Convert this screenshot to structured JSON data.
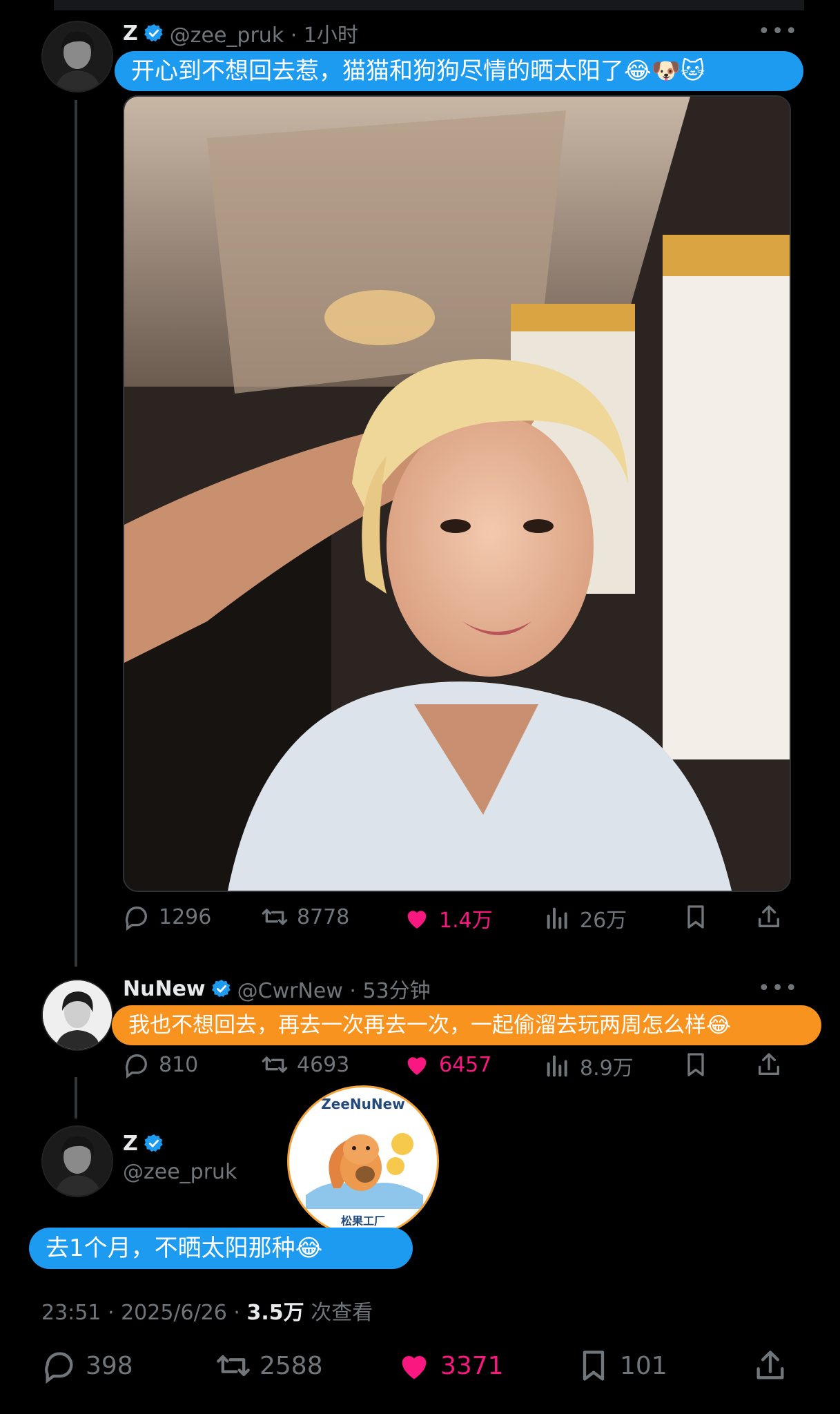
{
  "tweet1": {
    "name": "Z",
    "handle_time": "@zee_pruk · 1小时",
    "text": "开心到不想回去惹，猫猫和狗狗尽情的晒太阳了",
    "emoji_tail": "😂🐶🐱",
    "stats": {
      "replies": "1296",
      "retweets": "8778",
      "likes": "1.4万",
      "views": "26万"
    }
  },
  "tweet2": {
    "name": "NuNew",
    "handle_time": "@CwrNew · 53分钟",
    "text": "我也不想回去，再去一次再去一次，一起偷溜去玩两周怎么样",
    "emoji_tail": "😂",
    "stats": {
      "replies": "810",
      "retweets": "4693",
      "likes": "6457",
      "views": "8.9万"
    }
  },
  "tweet3": {
    "name": "Z",
    "handle": "@zee_pruk",
    "text": "去1个月，不晒太阳那种",
    "emoji_tail": "😂",
    "time": "23:51 · 2025/6/26 · ",
    "views_count": "3.5万",
    "views_label": " 次查看",
    "stats": {
      "replies": "398",
      "retweets": "2588",
      "likes": "3371",
      "bookmarks": "101"
    }
  },
  "watermark": {
    "top": "ZeeNuNew",
    "bottom": "松果工厂"
  },
  "colors": {
    "accent_blue": "#1d9bf0",
    "accent_orange": "#f7931e",
    "like_pink": "#f91880",
    "muted": "#71767b"
  }
}
